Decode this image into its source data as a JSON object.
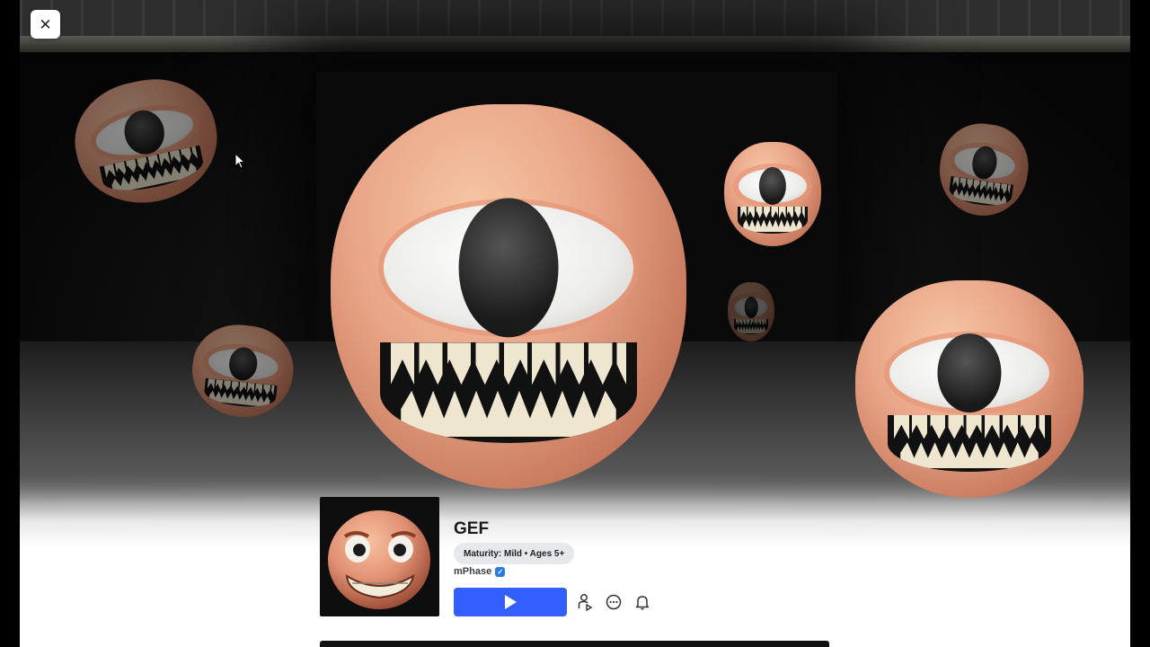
{
  "window": {
    "close_icon": "close-icon"
  },
  "game": {
    "title": "GEF",
    "maturity": "Maturity: Mild • Ages 5+",
    "creator": "mPhase",
    "creator_verified_icon": "verified-badge-icon"
  },
  "actions": {
    "play_icon": "play-icon",
    "friends_icon": "add-friend-icon",
    "chat_icon": "chat-bubble-icon",
    "notify_icon": "bell-icon"
  },
  "colors": {
    "play_button": "#335fff",
    "verified_badge": "#2a7be4",
    "maturity_pill": "#e6e8ec"
  }
}
